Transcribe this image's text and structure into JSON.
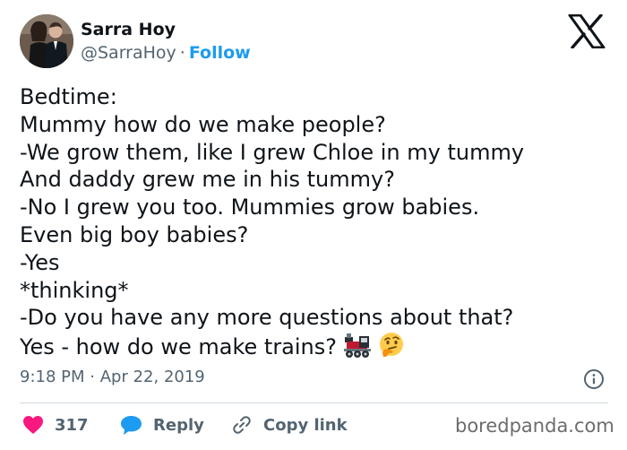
{
  "author": {
    "display_name": "Sarra Hoy",
    "handle": "@SarraHoy",
    "separator": "·",
    "follow_label": "Follow"
  },
  "platform_icon": "x-logo-icon",
  "tweet": {
    "lines": [
      "Bedtime:",
      "Mummy how do we make people?",
      "-We grow them, like I grew Chloe in my tummy",
      "And daddy grew me in his tummy?",
      "-No I grew you too. Mummies grow babies.",
      "Even big boy babies?",
      "-Yes",
      "*thinking*",
      "-Do you have any more questions about that?",
      "Yes - how do we make trains?"
    ],
    "emojis": [
      "steam-locomotive-icon",
      "thinking-face-icon"
    ]
  },
  "meta": {
    "time": "9:18 PM",
    "separator": "·",
    "date": "Apr 22, 2019"
  },
  "actions": {
    "like_count": "317",
    "reply_label": "Reply",
    "copy_link_label": "Copy link"
  },
  "watermark": "boredpanda.com",
  "colors": {
    "text": "#0f1419",
    "secondary": "#536471",
    "accent": "#1d9bf0",
    "like": "#f91880",
    "divider": "#cfd9de"
  }
}
